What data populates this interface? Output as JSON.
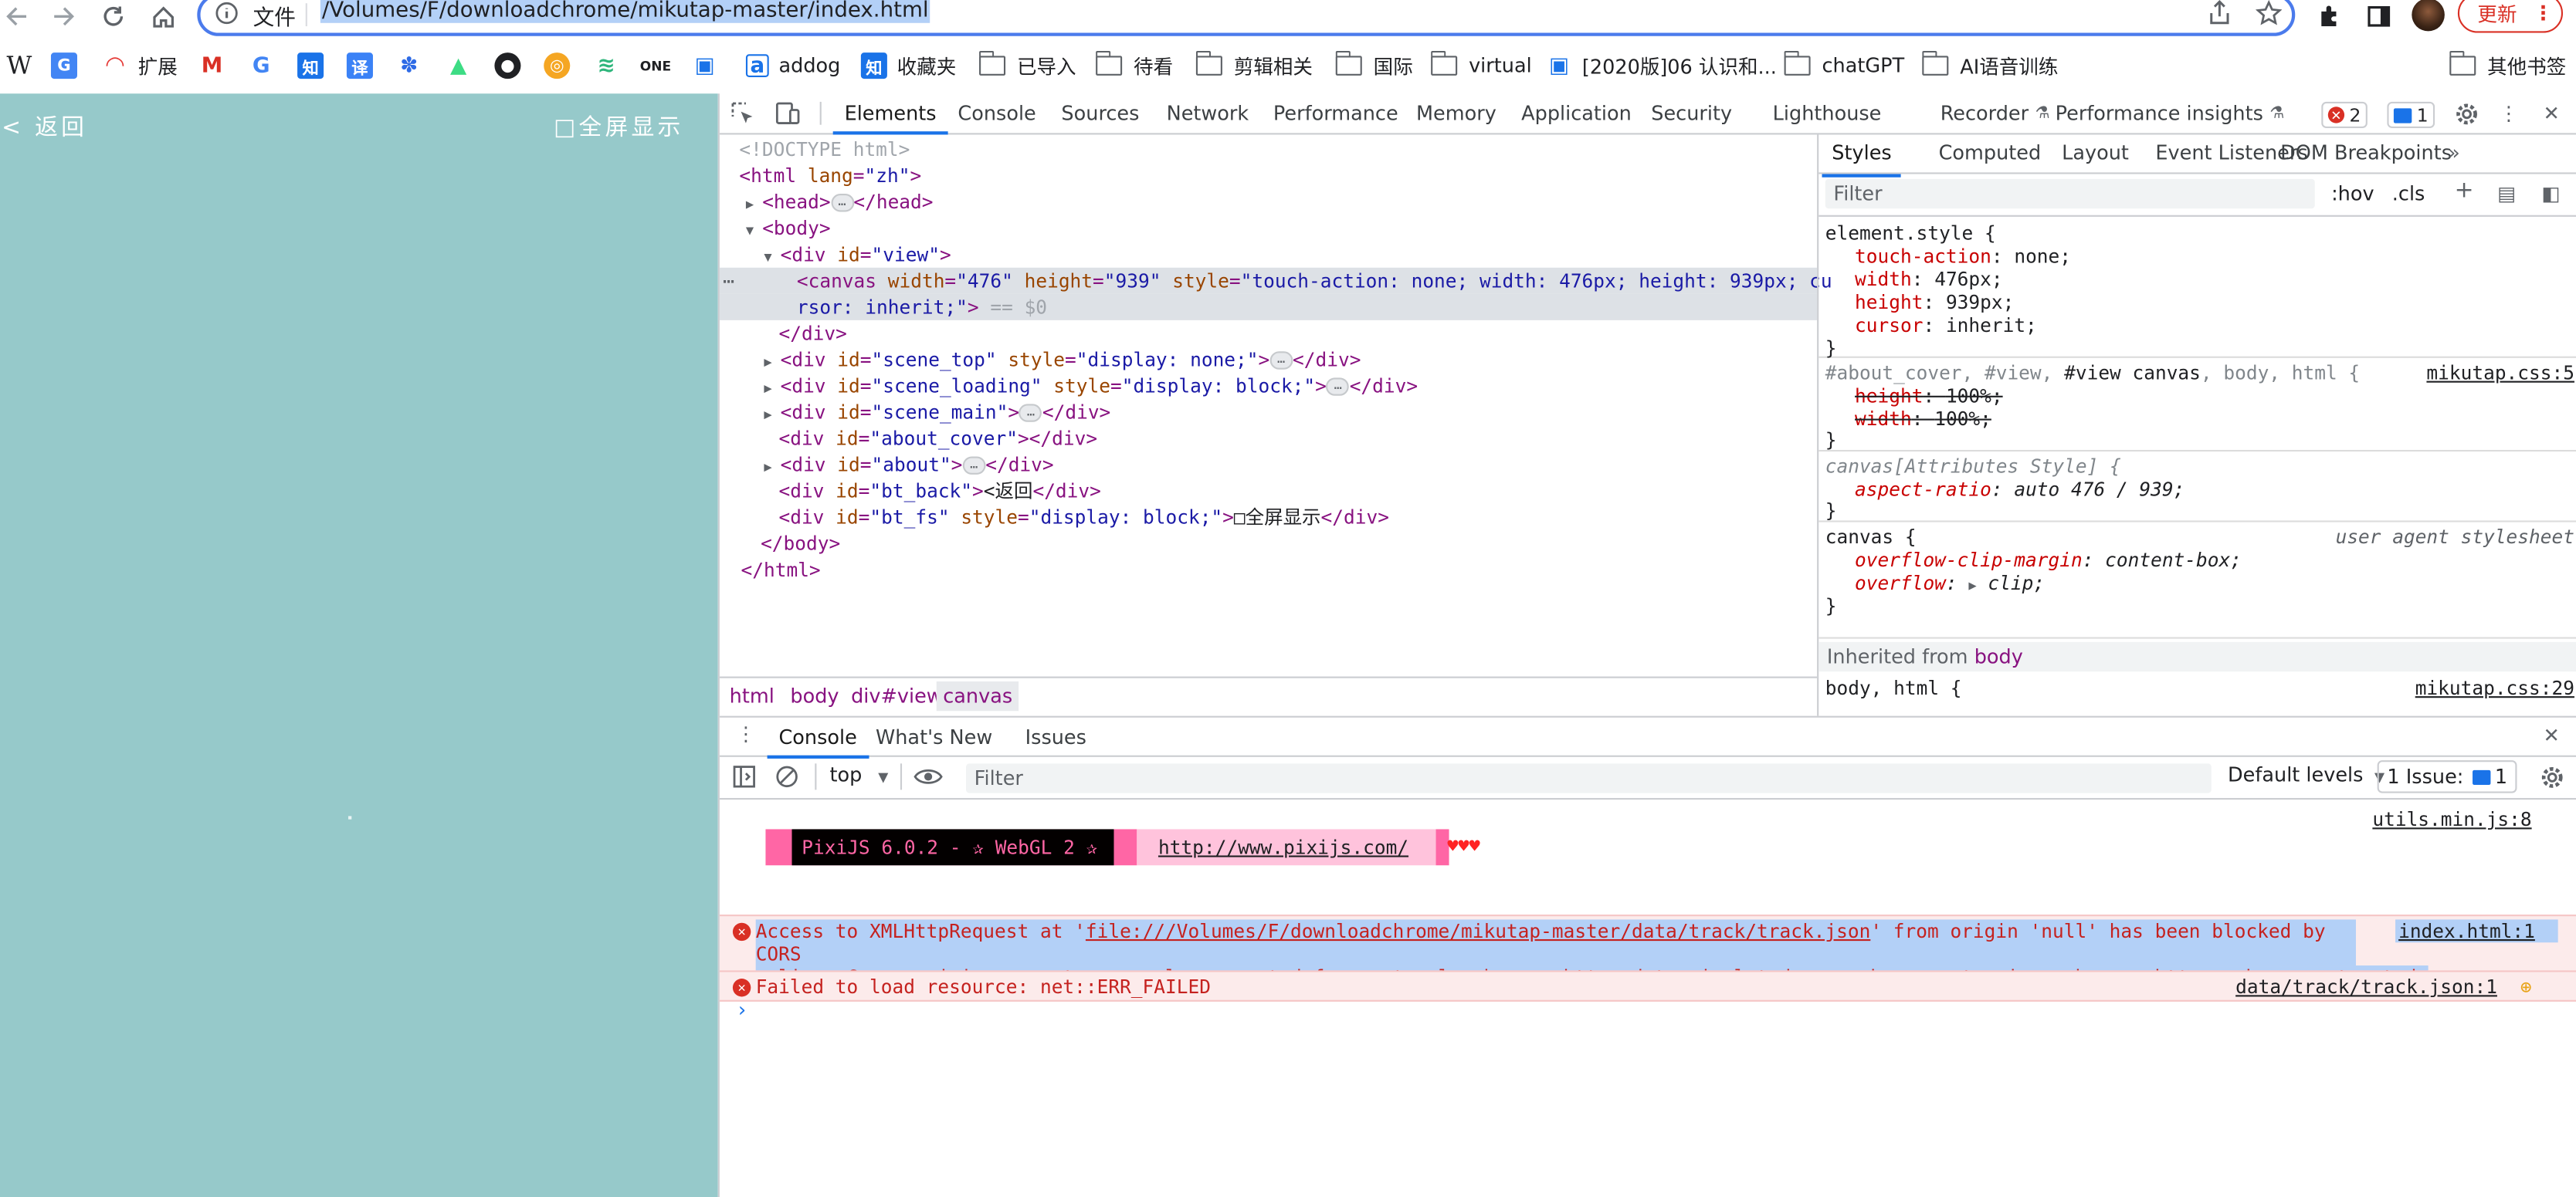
{
  "browser": {
    "url_scheme": "文件",
    "url": "/Volumes/F/downloadchrome/mikutap-master/index.html",
    "update_label": "更新",
    "bookmarks": [
      {
        "label": "扩展",
        "icon": "rainbow-icon",
        "color": "#e53935"
      },
      {
        "label": "addog",
        "icon": "addog-icon",
        "color": "#1a73e8"
      },
      {
        "label": "收藏夹",
        "icon": "zhihu-icon",
        "color": "#1a73e8"
      },
      {
        "label": "已导入",
        "icon": "folder-icon"
      },
      {
        "label": "待看",
        "icon": "folder-icon"
      },
      {
        "label": "剪辑相关",
        "icon": "folder-icon"
      },
      {
        "label": "国际",
        "icon": "folder-icon"
      },
      {
        "label": "virtual",
        "icon": "folder-icon"
      },
      {
        "label": "[2020版]06 认识和...",
        "icon": "bilibili-icon",
        "color": "#1a73e8"
      },
      {
        "label": "chatGPT",
        "icon": "folder-icon"
      },
      {
        "label": "AI语音训练",
        "icon": "folder-icon"
      },
      {
        "label": "其他书签",
        "icon": "folder-icon"
      }
    ]
  },
  "page": {
    "back_label": "< 返回",
    "fullscreen_label": "□全屏显示",
    "background": "#96c9ca"
  },
  "devtools": {
    "tabs": [
      "Elements",
      "Console",
      "Sources",
      "Network",
      "Performance",
      "Memory",
      "Application",
      "Security",
      "Lighthouse",
      "Recorder",
      "Performance insights"
    ],
    "error_count": "2",
    "message_count": "1",
    "elements_tree": {
      "doctype": "<!DOCTYPE html>",
      "html_attr_val": "\"zh\"",
      "canvas_width": "\"476\"",
      "canvas_height": "\"939\"",
      "canvas_style_1": "\"touch-action: none; width: 476px; height: 939px; cu",
      "canvas_style_2": "rsor: inherit;\"",
      "dollar0": "== $0",
      "scene_top_id": "\"scene_top\"",
      "scene_top_style": "\"display: none;\"",
      "scene_loading_id": "\"scene_loading\"",
      "scene_loading_style": "\"display: block;\"",
      "scene_main_id": "\"scene_main\"",
      "about_cover_id": "\"about_cover\"",
      "about_id": "\"about\"",
      "bt_back_id": "\"bt_back\"",
      "bt_back_text": "<返回",
      "bt_fs_id": "\"bt_fs\"",
      "bt_fs_style": "\"display: block;\"",
      "bt_fs_text": "□全屏显示",
      "view_id": "\"view\""
    },
    "breadcrumb": [
      "html",
      "body",
      "div#view",
      "canvas"
    ],
    "styles": {
      "tabs": [
        "Styles",
        "Computed",
        "Layout",
        "Event Listeners",
        "DOM Breakpoints"
      ],
      "filter_placeholder": "Filter",
      "hov": ":hov",
      "cls": ".cls",
      "rule1": {
        "selector": "element.style {",
        "props": [
          {
            "name": "touch-action",
            "value": "none;"
          },
          {
            "name": "width",
            "value": "476px;"
          },
          {
            "name": "height",
            "value": "939px;"
          },
          {
            "name": "cursor",
            "value": "inherit;"
          }
        ]
      },
      "rule2": {
        "selector_dim": "#about_cover, #view, ",
        "selector_match": "#view canvas",
        "selector_tail": ", body, html {",
        "source": "mikutap.css:5",
        "props": [
          {
            "name": "height",
            "value": "100%;"
          },
          {
            "name": "width",
            "value": "100%;"
          }
        ]
      },
      "rule3": {
        "selector": "canvas[Attributes Style] {",
        "prop": "aspect-ratio",
        "value": "auto 476 / 939;"
      },
      "rule4": {
        "selector": "canvas {",
        "source": "user agent stylesheet",
        "props": [
          {
            "name": "overflow-clip-margin",
            "value": "content-box;"
          },
          {
            "name": "overflow",
            "value": "clip;"
          }
        ]
      },
      "inherited_label": "Inherited from",
      "inherited_from": "body",
      "rule5": {
        "selector": "body, html {",
        "source": "mikutap.css:29"
      }
    },
    "drawer_tabs": [
      "Console",
      "What's New",
      "Issues"
    ],
    "console": {
      "context": "top",
      "filter_placeholder": "Filter",
      "levels": "Default levels",
      "issues": "1 Issue:",
      "issues_count": "1",
      "pixi_label": "PixiJS 6.0.2 - ✰ WebGL 2 ✰",
      "pixi_url": "http://www.pixijs.com/",
      "pixi_hearts": "♥♥♥",
      "pixi_source": "utils.min.js:8",
      "error1_prefix": "Access to XMLHttpRequest at '",
      "error1_url": "file:///Volumes/F/downloadchrome/mikutap-master/data/track/track.json",
      "error1_rest": "' from origin 'null' has been blocked by CORS",
      "error1_line2": "policy: Cross origin requests are only supported for protocol schemes: http, data, isolated-app, chrome-extension, chrome, https, chrome-untrusted.",
      "error1_source": "index.html:1",
      "error2": "Failed to load resource: net::ERR_FAILED",
      "error2_source": "data/track/track.json:1"
    }
  }
}
